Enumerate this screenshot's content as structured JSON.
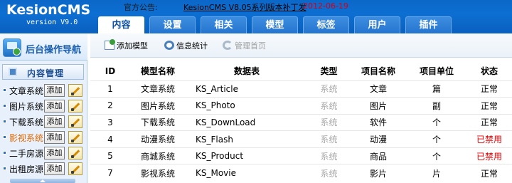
{
  "app": {
    "title": "KesionCMS",
    "version": "version V9.0"
  },
  "notice": {
    "label": "官方公告:",
    "text": "KesionCMS V8.05系列版本补丁发",
    "date": "2012-06-19"
  },
  "tabs": [
    {
      "label": "内容",
      "active": true
    },
    {
      "label": "设置",
      "active": false
    },
    {
      "label": "相关",
      "active": false
    },
    {
      "label": "模型",
      "active": false
    },
    {
      "label": "标签",
      "active": false
    },
    {
      "label": "用户",
      "active": false
    },
    {
      "label": "插件",
      "active": false
    }
  ],
  "sidebar": {
    "nav_title": "后台操作导航",
    "section_title": "内容管理",
    "add_label": "添加",
    "items": [
      {
        "label": "文章系统",
        "highlight": false
      },
      {
        "label": "图片系统",
        "highlight": false
      },
      {
        "label": "下载系统",
        "highlight": false
      },
      {
        "label": "影视系统",
        "highlight": true
      },
      {
        "label": "二手房源",
        "highlight": false
      },
      {
        "label": "出租房源",
        "highlight": false
      }
    ]
  },
  "toolbar": {
    "add_model": "添加模型",
    "info_stats": "信息统计",
    "manage_home": "管理首页"
  },
  "table": {
    "headers": [
      "ID",
      "模型名称",
      "数据表",
      "类型",
      "项目名称",
      "项目单位",
      "状态"
    ],
    "rows": [
      {
        "id": "1",
        "name": "文章系统",
        "table": "KS_Article",
        "type": "系统",
        "item": "文章",
        "unit": "篇",
        "status": "正常",
        "disabled": false
      },
      {
        "id": "2",
        "name": "图片系统",
        "table": "KS_Photo",
        "type": "系统",
        "item": "图片",
        "unit": "副",
        "status": "正常",
        "disabled": false
      },
      {
        "id": "3",
        "name": "下载系统",
        "table": "KS_DownLoad",
        "type": "系统",
        "item": "软件",
        "unit": "个",
        "status": "正常",
        "disabled": false
      },
      {
        "id": "4",
        "name": "动漫系统",
        "table": "KS_Flash",
        "type": "系统",
        "item": "动漫",
        "unit": "个",
        "status": "已禁用",
        "disabled": true
      },
      {
        "id": "5",
        "name": "商城系统",
        "table": "KS_Product",
        "type": "系统",
        "item": "商品",
        "unit": "个",
        "status": "已禁用",
        "disabled": true
      },
      {
        "id": "7",
        "name": "影视系统",
        "table": "KS_Movie",
        "type": "系统",
        "item": "影片",
        "unit": "片",
        "status": "正常",
        "disabled": false
      }
    ]
  },
  "colors": {
    "header_blue": "#0b67c8",
    "disabled_red": "#e00000",
    "highlight_orange": "#e26a00",
    "date_red": "#d4001c"
  }
}
